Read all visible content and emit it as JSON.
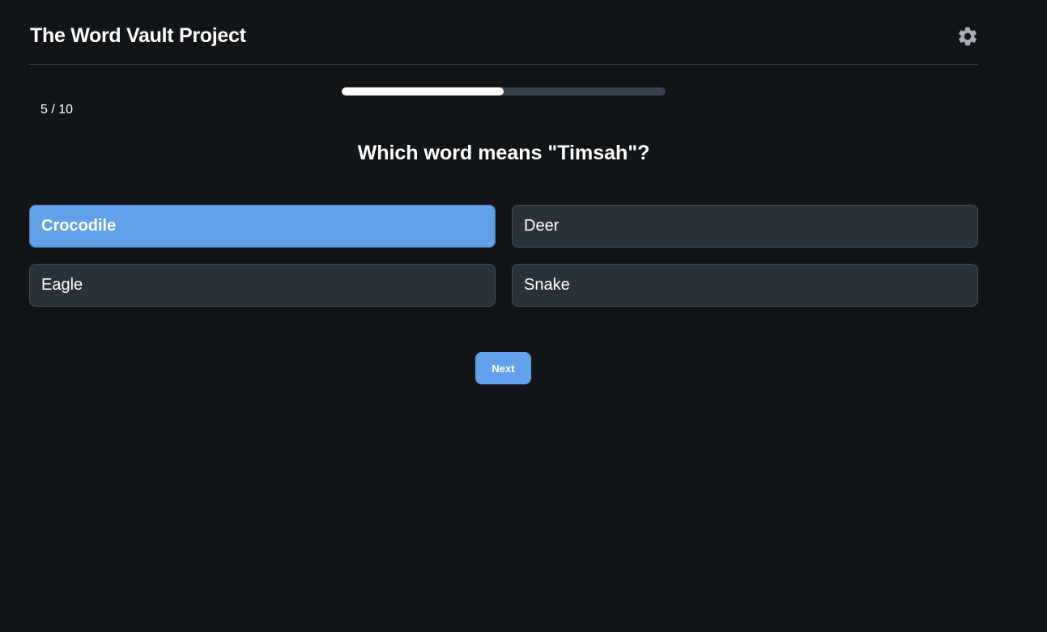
{
  "app": {
    "title": "The Word Vault Project",
    "settings_icon": "gear-icon"
  },
  "progress": {
    "current": 5,
    "total": 10,
    "fraction": 0.5,
    "label": "5 / 10"
  },
  "question": {
    "text": "Which word means \"Timsah\"?"
  },
  "options": [
    {
      "label": "Crocodile",
      "selected": true
    },
    {
      "label": "Deer",
      "selected": false
    },
    {
      "label": "Eagle",
      "selected": false
    },
    {
      "label": "Snake",
      "selected": false
    }
  ],
  "actions": {
    "next_label": "Next"
  },
  "colors": {
    "background": "#121518",
    "accent": "#62a0ea",
    "option_bg": "#2b3139",
    "track": "#3a414b"
  }
}
